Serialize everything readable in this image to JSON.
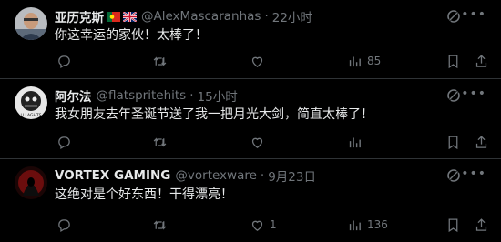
{
  "tweets": [
    {
      "name": "亚历克斯",
      "flags": [
        "portugal-flag",
        "uk-flag"
      ],
      "handle": "@AlexMascaranhas",
      "time": "22小时",
      "text": "你这幸运的家伙！太棒了！",
      "replies": "",
      "retweets": "",
      "likes": "",
      "views": "85"
    },
    {
      "name": "阿尔法",
      "handle": "@flatspritehits",
      "time": "15小时",
      "text": "我女朋友去年圣诞节送了我一把月光大剑，简直太棒了！",
      "replies": "",
      "retweets": "",
      "likes": "",
      "views": "",
      "avatar_text": "LLLAGHTS"
    },
    {
      "name": "VORTEX GAMING",
      "handle": "@vortexware",
      "time": "9月23日",
      "text": "这绝对是个好东西！干得漂亮！",
      "replies": "",
      "retweets": "",
      "likes": "1",
      "views": "136"
    }
  ],
  "separator": "·",
  "colors": {
    "background": "#000000",
    "text": "#e7e9ea",
    "muted": "#71767b",
    "border": "#2f3336"
  }
}
